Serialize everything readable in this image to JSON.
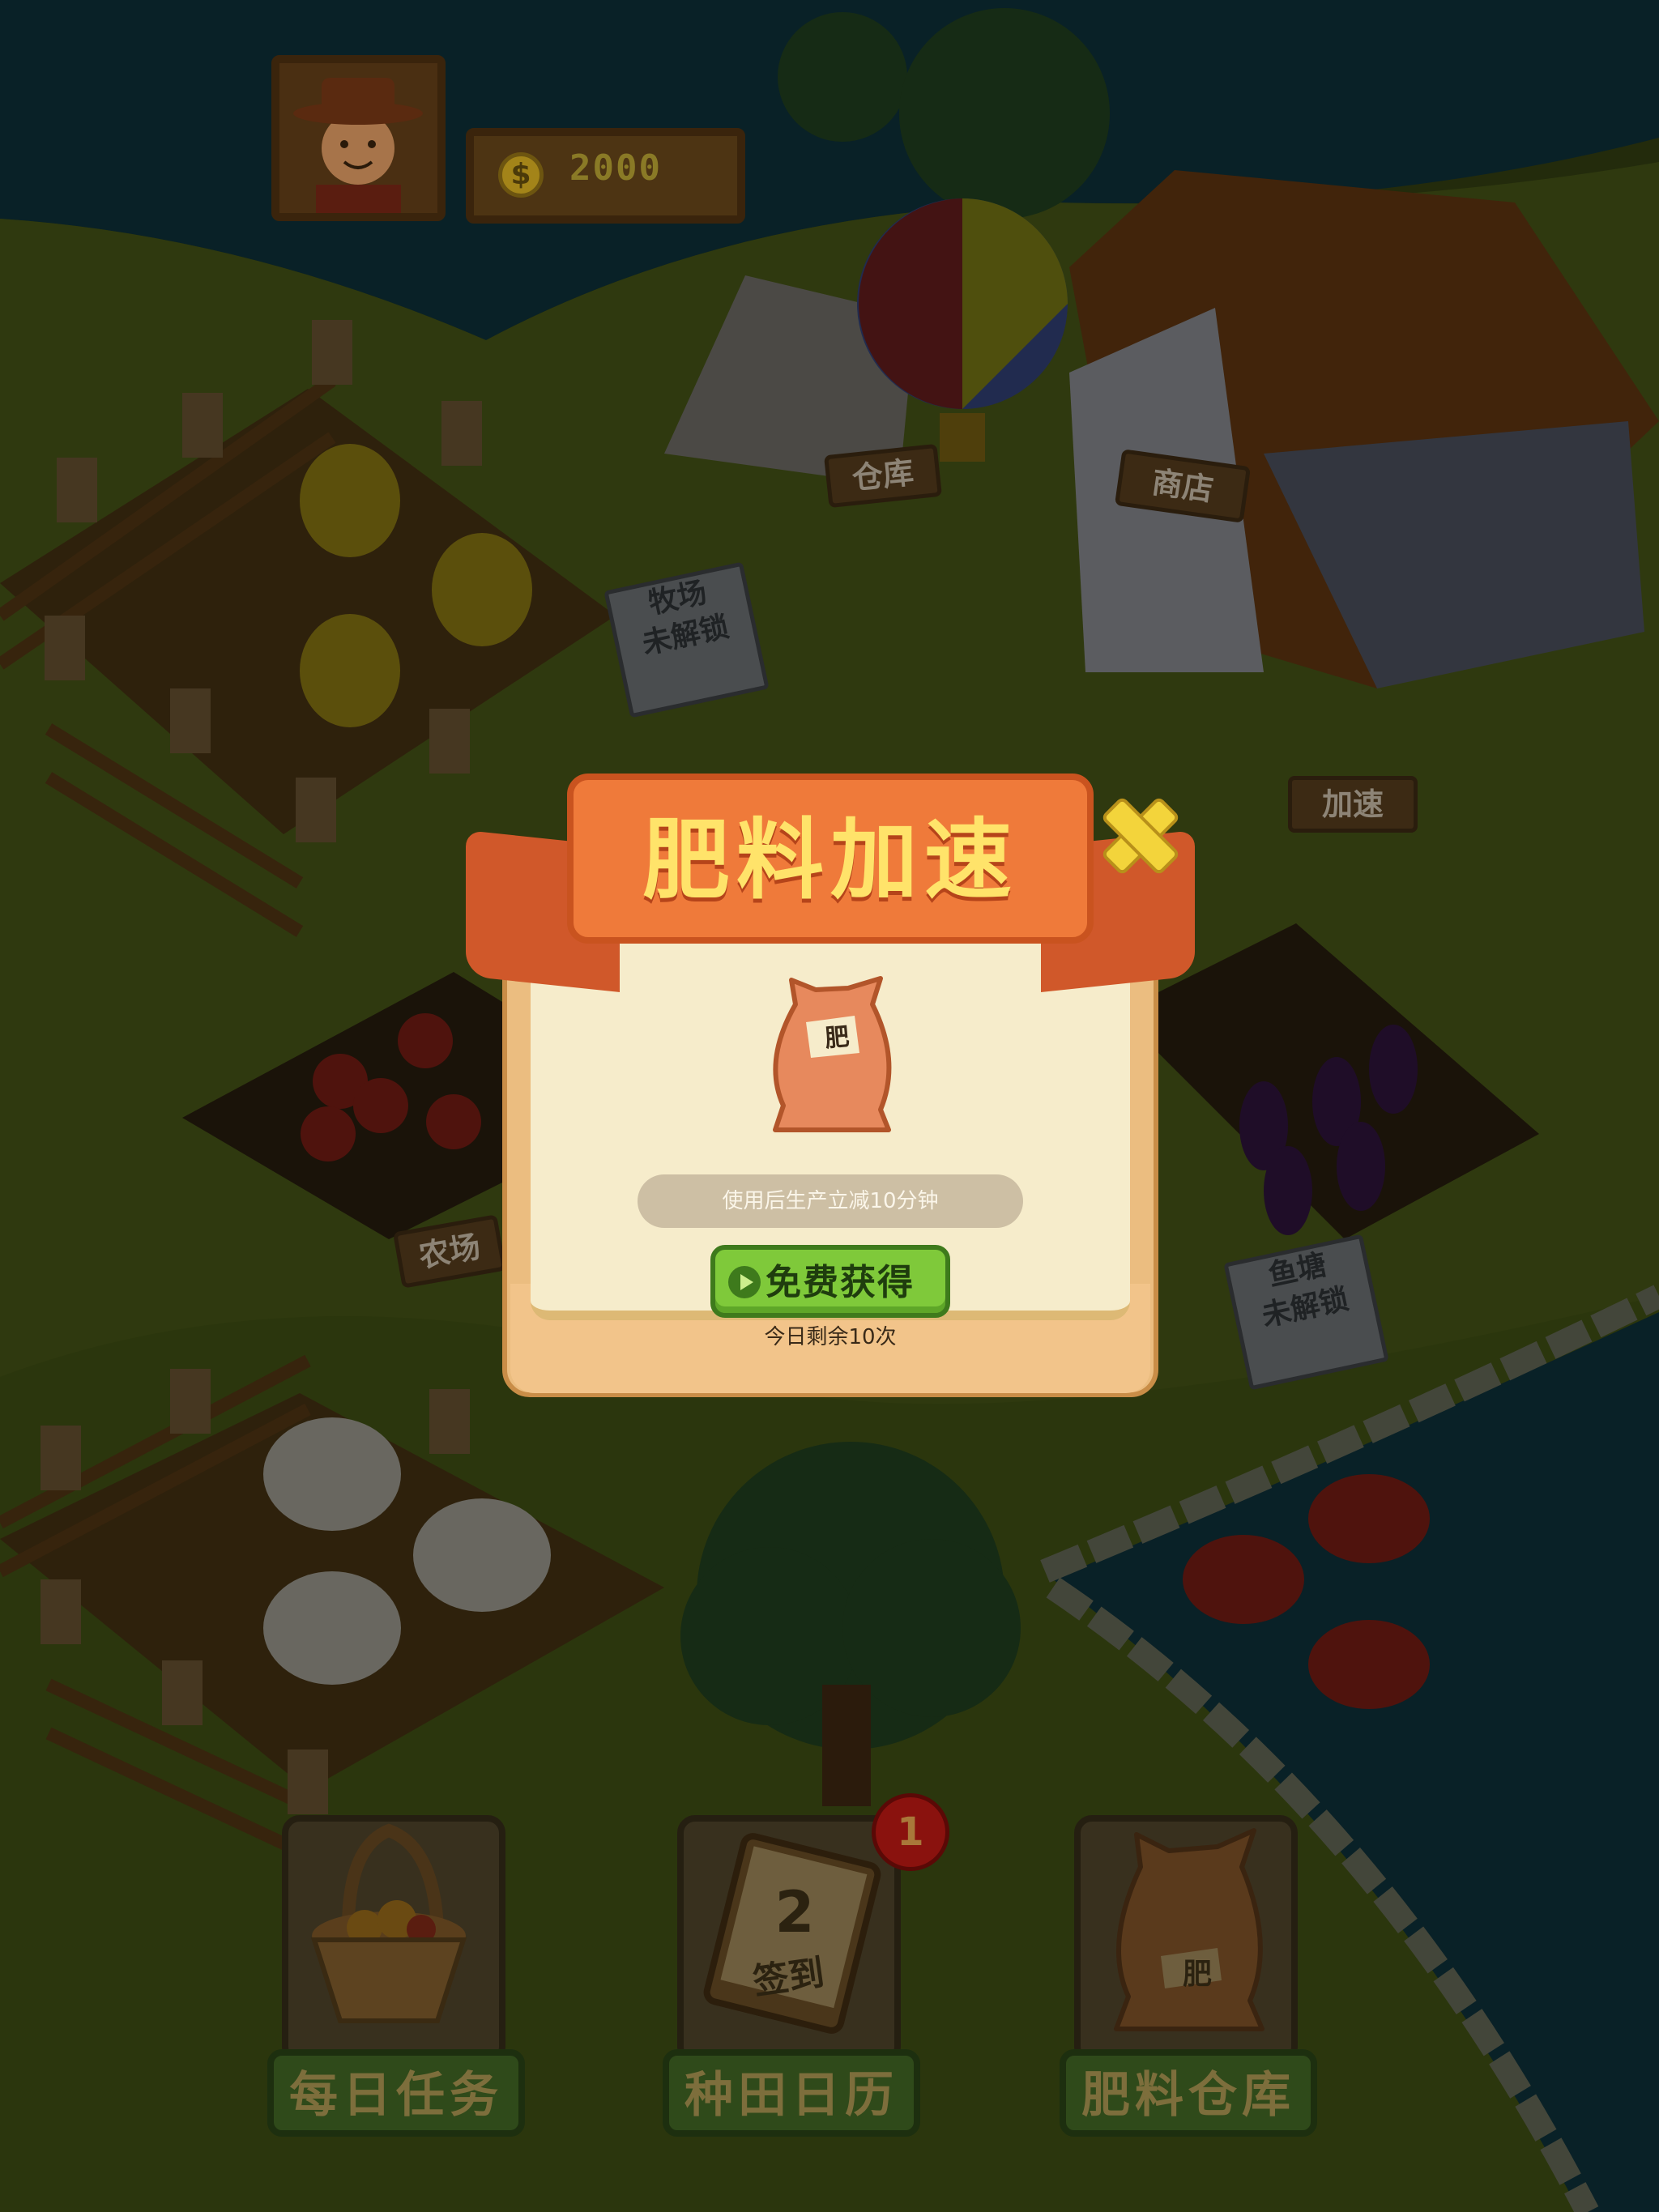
{
  "hud": {
    "coins": "2000",
    "coin_symbol": "$"
  },
  "map_signs": {
    "warehouse": "仓库",
    "shop": "商店",
    "speedup": "加速",
    "ranch": "牧场",
    "ranch_status": "未解锁",
    "farm": "农场",
    "fishpond": "鱼塘",
    "fishpond_status": "未解锁"
  },
  "popup": {
    "title": "肥料加速",
    "item_label": "肥",
    "effect_text": "使用后生产立减10分钟",
    "free_get_button": "免费获得",
    "remaining_text": "今日剩余10次"
  },
  "bottom_bar": {
    "daily_tasks": "每日任务",
    "farming_calendar": "种田日历",
    "calendar_day": "2",
    "calendar_checkin": "签到",
    "calendar_badge_count": "1",
    "fertilizer_warehouse": "肥料仓库",
    "fertilizer_bag_label": "肥"
  },
  "colors": {
    "popup_ribbon": "#ef7a3a",
    "popup_title": "#ffe36a",
    "close_icon": "#f3d43b",
    "free_button": "#7fc93a",
    "dim_overlay": "rgba(0,0,0,0.55)"
  }
}
